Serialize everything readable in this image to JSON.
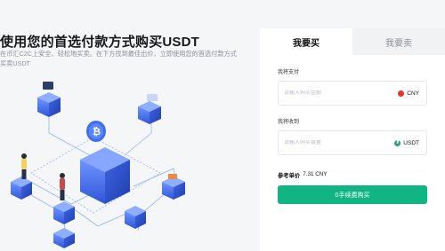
{
  "hero": {
    "title": "使用您的首选付款方式购买USDT",
    "subtitle": "在币汇C2C上安全、轻松地买卖。在下方找到最佳出价，立即使用您的首选付款方式买卖USDT"
  },
  "trade_card": {
    "tabs": [
      {
        "label": "我要买",
        "active": true
      },
      {
        "label": "我要卖",
        "active": false
      }
    ],
    "pay": {
      "label": "我将支付",
      "placeholder": "请输入购买金额",
      "value": "",
      "currency": "CNY",
      "currency_icon": "cny-flag-icon"
    },
    "receive": {
      "label": "我将收到",
      "placeholder": "请输入购买数量",
      "value": "",
      "currency": "USDT",
      "currency_icon": "tether-icon"
    },
    "reference_price": {
      "label": "参考单价",
      "value": "7.31 CNY"
    },
    "buy_button": "0手续费购买"
  },
  "colors": {
    "accent": "#10b582",
    "cny_red": "#e1352e",
    "usdt_green": "#26a17b",
    "iso_blue": "#4a78f0"
  }
}
